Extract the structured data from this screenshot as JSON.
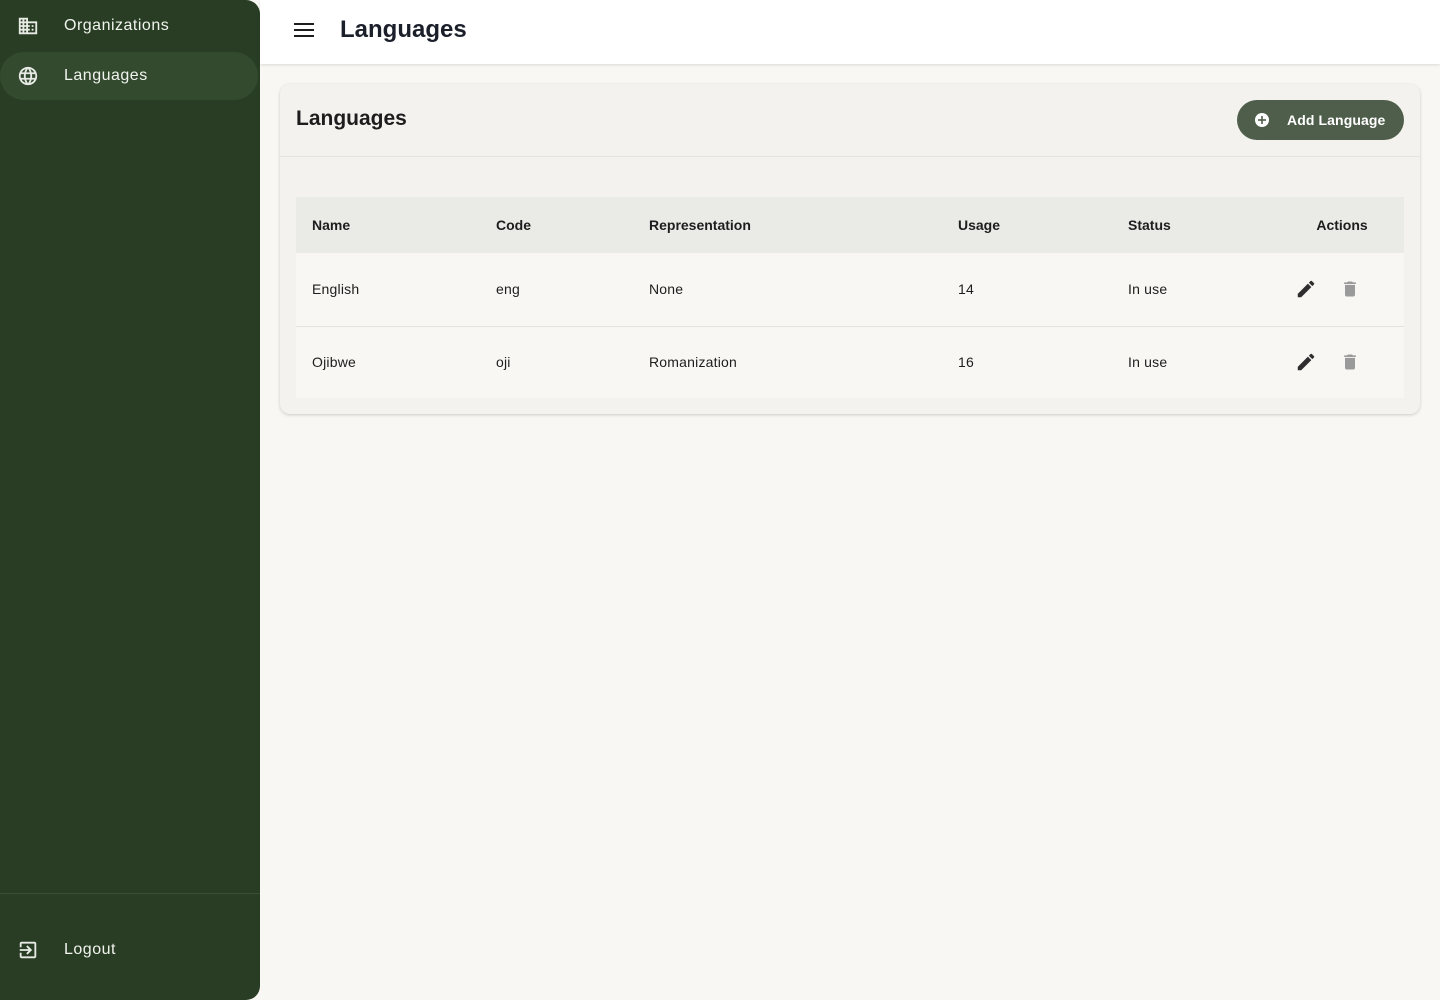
{
  "sidebar": {
    "items": [
      {
        "label": "Organizations",
        "icon": "building-icon"
      },
      {
        "label": "Languages",
        "icon": "globe-icon",
        "active": true
      }
    ],
    "logout_label": "Logout"
  },
  "topbar": {
    "title": "Languages"
  },
  "card": {
    "title": "Languages",
    "add_button_label": "Add Language"
  },
  "table": {
    "headers": [
      "Name",
      "Code",
      "Representation",
      "Usage",
      "Status",
      "Actions"
    ],
    "rows": [
      {
        "name": "English",
        "code": "eng",
        "representation": "None",
        "usage": "14",
        "status": "In use"
      },
      {
        "name": "Ojibwe",
        "code": "oji",
        "representation": "Romanization",
        "usage": "16",
        "status": "In use"
      }
    ]
  },
  "colors": {
    "sidebar_bg": "#283d24",
    "accent_button": "#4e5e4a",
    "page_bg": "#f8f7f3"
  }
}
